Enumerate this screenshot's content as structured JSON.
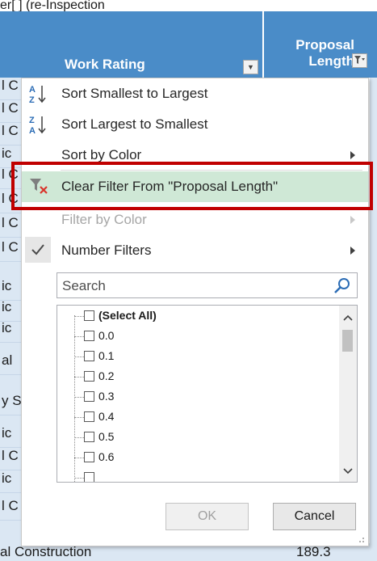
{
  "sheet": {
    "top_partial_text": "er[ ] (re-Inspection",
    "headers": {
      "work_rating": "Work Rating",
      "proposal_length_line1": "Proposal",
      "proposal_length_line2": "Length"
    },
    "left_cells": [
      "l C",
      "l C",
      "l C",
      "ic",
      "l C",
      "l C",
      "l C",
      "l C",
      "ic",
      "ic",
      "ic",
      "al",
      "y S",
      "ic",
      "l C",
      "ic",
      "l C"
    ],
    "bottom_row": {
      "left_text": "al Construction",
      "right_value": "189.3"
    }
  },
  "filter_menu": {
    "items": [
      {
        "label": "Sort Smallest to Largest",
        "icon": "sort-ascending-icon",
        "enabled": true
      },
      {
        "label": "Sort Largest to Smallest",
        "icon": "sort-descending-icon",
        "enabled": true
      },
      {
        "label": "Sort by Color",
        "enabled": true,
        "submenu": true
      },
      {
        "label": "Clear Filter From \"Proposal Length\"",
        "icon": "clear-filter-icon",
        "enabled": true,
        "highlighted": true
      },
      {
        "label": "Filter by Color",
        "enabled": false,
        "submenu": true
      },
      {
        "label": "Number Filters",
        "enabled": true,
        "checked": true,
        "submenu": true
      }
    ],
    "search": {
      "placeholder": "Search"
    },
    "values": [
      "(Select All)",
      "0.0",
      "0.1",
      "0.2",
      "0.3",
      "0.4",
      "0.5",
      "0.6"
    ],
    "ok_label": "OK",
    "cancel_label": "Cancel"
  },
  "colors": {
    "header_blue": "#4a8cc8",
    "row_blue": "#dbe7f3",
    "highlight_green": "#cfe8d6",
    "annotation_red": "#c00000"
  }
}
